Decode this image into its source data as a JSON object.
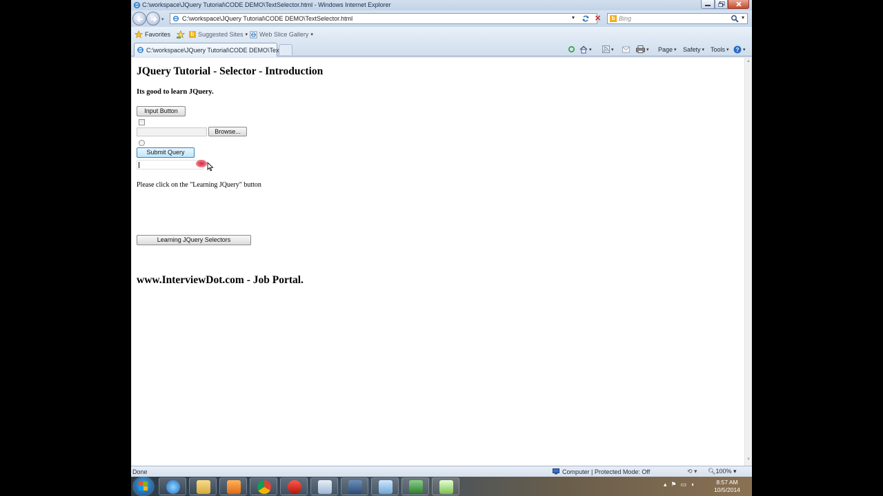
{
  "window": {
    "title": "C:\\workspace\\JQuery Tutorial\\CODE DEMO\\TextSelector.html - Windows Internet Explorer"
  },
  "address_bar": {
    "url": "C:\\workspace\\JQuery Tutorial\\CODE DEMO\\TextSelector.html"
  },
  "search": {
    "placeholder": "Bing"
  },
  "favorites_bar": {
    "favorites_label": "Favorites",
    "suggested_sites_label": "Suggested Sites",
    "web_slice_gallery_label": "Web Slice Gallery"
  },
  "tabs": [
    {
      "label": "C:\\workspace\\JQuery Tutorial\\CODE DEMO\\Text..."
    }
  ],
  "command_bar": {
    "page_label": "Page",
    "safety_label": "Safety",
    "tools_label": "Tools"
  },
  "page": {
    "heading": "JQuery Tutorial - Selector - Introduction",
    "intro": "Its good to learn JQuery.",
    "input_button_label": "Input Button",
    "browse_button_label": "Browse...",
    "submit_button_label": "Submit Query",
    "instruction": "Please click on the \"Learning JQuery\" button",
    "learning_button_label": "Learning JQuery Selectors",
    "footer": "www.InterviewDot.com - Job Portal."
  },
  "status_bar": {
    "status": "Done",
    "zone": "Computer | Protected Mode: Off",
    "zoom": "100%"
  },
  "taskbar": {
    "time": "8:57 AM",
    "date": "10/5/2014"
  },
  "colors": {
    "chrome_blue": "#dfe8f3",
    "close_red": "#c64a2f",
    "bing_orange": "#f3b01b",
    "submit_focus_blue": "#3c7fb1"
  },
  "icons": {
    "title": "ie-icon",
    "back": "back-arrow-icon",
    "forward": "forward-arrow-icon",
    "refresh": "refresh-icon",
    "stop": "stop-icon",
    "search": "magnifier-icon",
    "home": "home-icon",
    "feeds": "rss-icon",
    "mail": "mail-icon",
    "print": "printer-icon",
    "help": "help-icon",
    "zone": "computer-zone-icon"
  }
}
